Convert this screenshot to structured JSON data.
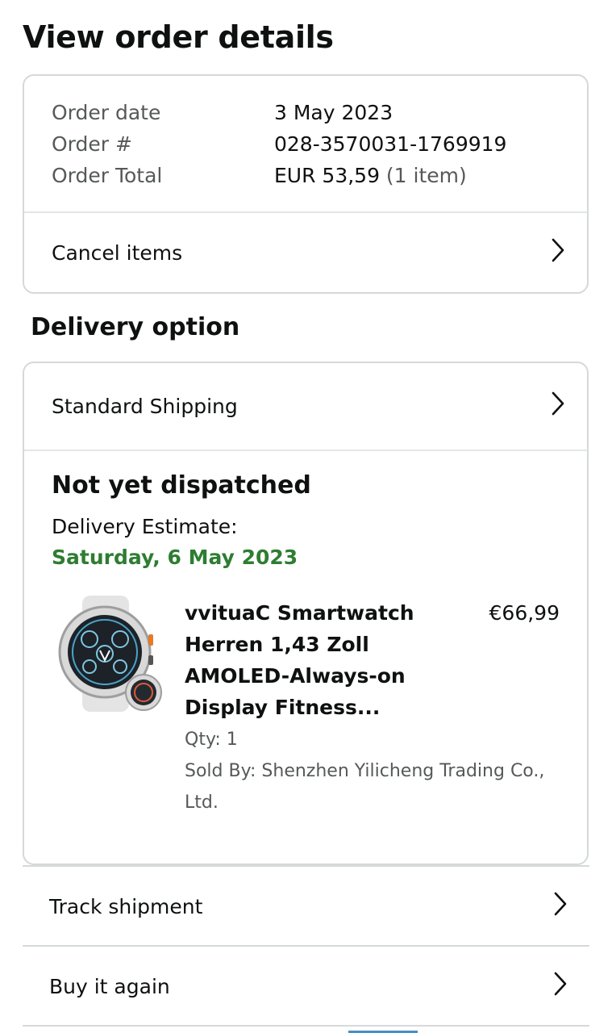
{
  "page": {
    "title": "View order details"
  },
  "summary": {
    "rows": [
      {
        "label": "Order date",
        "value": "3 May 2023",
        "extra": ""
      },
      {
        "label": "Order #",
        "value": "028-3570031-1769919",
        "extra": ""
      },
      {
        "label": "Order Total",
        "value": "EUR 53,59",
        "extra": " (1 item)"
      }
    ],
    "cancel_label": "Cancel items"
  },
  "delivery": {
    "section_title": "Delivery option",
    "shipping_label": "Standard Shipping",
    "status": "Not yet dispatched",
    "estimate_label": "Delivery Estimate:",
    "estimate_date": "Saturday, 6 May 2023",
    "estimate_color": "#2e7d32",
    "product": {
      "title": "vvituaC Smartwatch Herren 1,43 Zoll AMOLED-Always-on Display Fitness...",
      "price": "€66,99",
      "qty": "Qty: 1",
      "seller": "Sold By: Shenzhen Yilicheng Trading Co., Ltd.",
      "image_icon": "smartwatch-image"
    }
  },
  "actions": {
    "track_label": "Track shipment",
    "buy_again_label": "Buy it again"
  }
}
